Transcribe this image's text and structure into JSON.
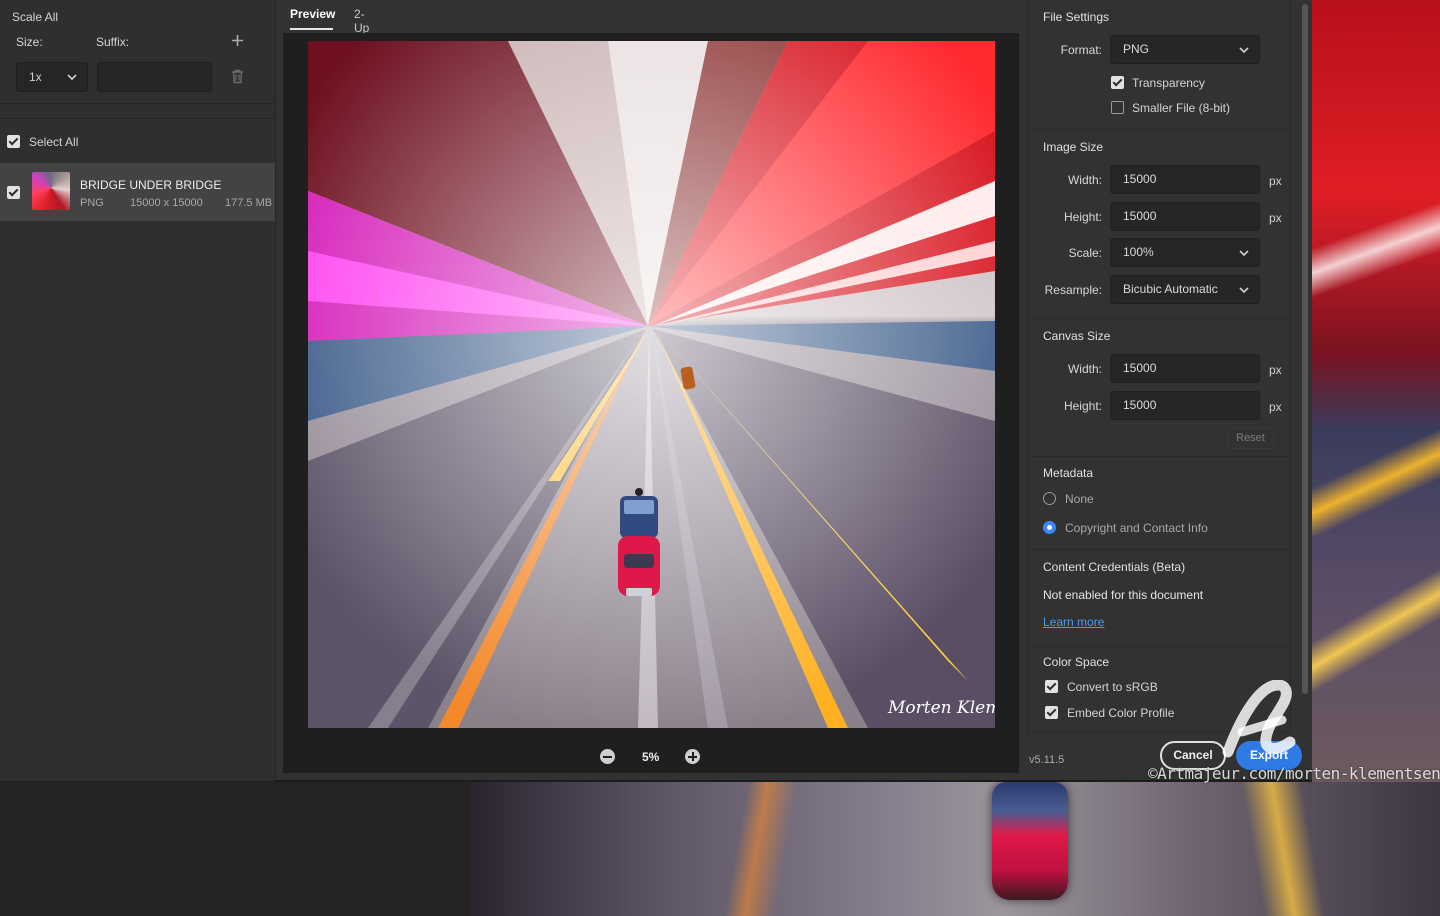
{
  "scale_panel": {
    "title": "Scale All",
    "size_label": "Size:",
    "suffix_label": "Suffix:",
    "size_value": "1x",
    "suffix_value": "",
    "add_icon": "plus-icon",
    "delete_icon": "trash-icon"
  },
  "asset_list": {
    "select_all_label": "Select All",
    "select_all_checked": true,
    "items": [
      {
        "name": "BRIDGE UNDER BRIDGE",
        "format": "PNG",
        "dimensions": "15000 x 15000",
        "file_size": "177.5 MB",
        "checked": true
      }
    ]
  },
  "preview": {
    "tabs": [
      {
        "label": "Preview",
        "active": true
      },
      {
        "label": "2-Up",
        "active": false
      }
    ],
    "zoom_level": "5%",
    "signature": "Morten Klementsen"
  },
  "file_settings": {
    "title": "File Settings",
    "format_label": "Format:",
    "format_value": "PNG",
    "transparency_label": "Transparency",
    "transparency_checked": true,
    "smaller_file_label": "Smaller File (8-bit)",
    "smaller_file_checked": false
  },
  "image_size": {
    "title": "Image Size",
    "width_label": "Width:",
    "width_value": "15000",
    "height_label": "Height:",
    "height_value": "15000",
    "unit": "px",
    "scale_label": "Scale:",
    "scale_value": "100%",
    "resample_label": "Resample:",
    "resample_value": "Bicubic Automatic"
  },
  "canvas_size": {
    "title": "Canvas Size",
    "width_label": "Width:",
    "width_value": "15000",
    "height_label": "Height:",
    "height_value": "15000",
    "unit": "px",
    "reset_label": "Reset"
  },
  "metadata": {
    "title": "Metadata",
    "options": [
      {
        "label": "None",
        "selected": false
      },
      {
        "label": "Copyright and Contact Info",
        "selected": true
      }
    ]
  },
  "content_credentials": {
    "title": "Content Credentials (Beta)",
    "status": "Not enabled for this document",
    "link": "Learn more"
  },
  "color_space": {
    "title": "Color Space",
    "convert_label": "Convert to sRGB",
    "convert_checked": true,
    "embed_label": "Embed Color Profile",
    "embed_checked": true
  },
  "footer": {
    "version": "v5.11.5",
    "cancel_label": "Cancel",
    "export_label": "Export"
  },
  "watermark": {
    "text": "©Artmajeur.com/morten-klementsen"
  },
  "colors": {
    "accent": "#2f7ae5",
    "panel": "#323232",
    "field": "#262626",
    "link": "#4a9cf2"
  }
}
